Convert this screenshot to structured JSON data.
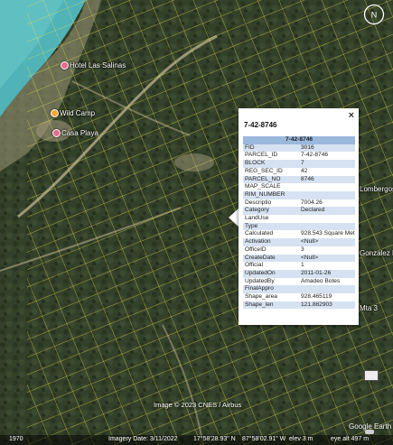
{
  "map": {
    "places": [
      {
        "name": "Hotel Las Salinas",
        "color": "#e36b8d"
      },
      {
        "name": "Wild Camp",
        "color": "#f0a830"
      },
      {
        "name": "Casa Playa",
        "color": "#e36b8d"
      }
    ],
    "street_labels": [
      "Lombergos Isla",
      "Gonzalez Prope",
      "Mta 3"
    ],
    "parcel_line_color": "#e8e64b",
    "water_color": "#4fb3b8",
    "vegetation_color": "#2f3a25"
  },
  "popup": {
    "title": "7-42-8746",
    "close_label": "×",
    "header": "7-42-8746",
    "rows": [
      {
        "k": "FID",
        "v": "3016"
      },
      {
        "k": "PARCEL_ID",
        "v": "7-42-8746"
      },
      {
        "k": "BLOCK",
        "v": "7"
      },
      {
        "k": "REG_SEC_ID",
        "v": "42"
      },
      {
        "k": "PARCEL_NO",
        "v": "8746"
      },
      {
        "k": "MAP_SCALE",
        "v": ""
      },
      {
        "k": "RIM_NUMBER",
        "v": ""
      },
      {
        "k": "Descriptio",
        "v": "7004.26"
      },
      {
        "k": "Category",
        "v": "Declared"
      },
      {
        "k": "LandUse",
        "v": ""
      },
      {
        "k": "Type",
        "v": ""
      },
      {
        "k": "Calculated",
        "v": "928.543 Square Meter(s)"
      },
      {
        "k": "Activation",
        "v": "<Null>"
      },
      {
        "k": "OfficeID",
        "v": "3"
      },
      {
        "k": "CreateDate",
        "v": "<Null>"
      },
      {
        "k": "Official",
        "v": "1"
      },
      {
        "k": "UpdatedOn",
        "v": "2011-01-26"
      },
      {
        "k": "UpdatedBy",
        "v": "Amadeo Botes"
      },
      {
        "k": "FinalAppro",
        "v": ""
      },
      {
        "k": "Shape_area",
        "v": "928.465119"
      },
      {
        "k": "Shape_len",
        "v": "121.882903"
      }
    ]
  },
  "footer": {
    "copyright": "Image © 2023 CNES / Airbus",
    "google": "Google Earth",
    "year": "1970",
    "imagery_date": "Imagery Date: 3/11/2022",
    "lat": "17°58'28.93\" N",
    "lon": "87°58'02.91\" W",
    "elev": "elev    3 m",
    "eye_alt": "eye alt   497 m"
  },
  "compass": {
    "label": "N"
  }
}
